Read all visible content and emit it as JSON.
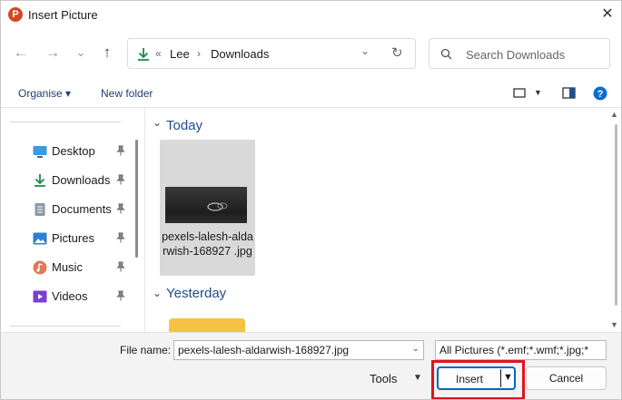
{
  "window": {
    "title": "Insert Picture",
    "app_icon_letter": "P",
    "close_glyph": "✕"
  },
  "nav": {
    "back_glyph": "←",
    "forward_glyph": "→",
    "recent_glyph": "⌄",
    "up_glyph": "↑"
  },
  "address": {
    "overflow_glyph": "«",
    "crumbs": [
      "Lee",
      "Downloads"
    ],
    "sep_glyph": "›",
    "dropdown_glyph": "⌄",
    "refresh_glyph": "↻"
  },
  "search": {
    "placeholder": "Search Downloads"
  },
  "toolbar": {
    "organise_label": "Organise ▾",
    "new_folder_label": "New folder"
  },
  "sidebar": {
    "items": [
      {
        "label": "Desktop",
        "icon": "desktop-icon"
      },
      {
        "label": "Downloads",
        "icon": "download-icon"
      },
      {
        "label": "Documents",
        "icon": "documents-icon"
      },
      {
        "label": "Pictures",
        "icon": "pictures-icon"
      },
      {
        "label": "Music",
        "icon": "music-icon"
      },
      {
        "label": "Videos",
        "icon": "videos-icon"
      }
    ]
  },
  "main": {
    "groups": [
      {
        "label": "Today",
        "files": [
          {
            "name": "pexels-lalesh-aldarwish-168927.jpg",
            "display_name": "pexels-lalesh-aldarwish-168927 .jpg",
            "kind": "image"
          }
        ]
      },
      {
        "label": "Yesterday",
        "files": [
          {
            "name": "",
            "kind": "folder"
          }
        ]
      }
    ],
    "chevron_glyph": "⌄"
  },
  "footer": {
    "file_name_label": "File name:",
    "file_name_value": "pexels-lalesh-aldarwish-168927.jpg",
    "file_type_value": "All Pictures (*.emf;*.wmf;*.jpg;*",
    "tools_label": "Tools",
    "insert_label": "Insert",
    "cancel_label": "Cancel"
  },
  "colors": {
    "accent": "#0067c0",
    "highlight": "#e0141e",
    "link": "#1f3e6e",
    "group_header": "#1f4e8c"
  }
}
